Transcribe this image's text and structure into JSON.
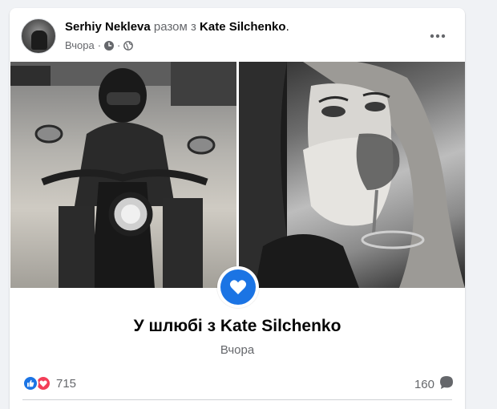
{
  "post": {
    "author_name": "Serhiy Nekleva",
    "with_text": "разом з",
    "tagged_name": "Kate Silchenko",
    "period": ".",
    "timestamp": "Вчора",
    "separator": "·",
    "icons": {
      "more": "more-horizontal-icon",
      "clock": "clock-icon",
      "audience": "globe-icon"
    }
  },
  "life_event": {
    "title": "У шлюбі з Kate Silchenko",
    "date": "Вчора",
    "icon": "heart-icon",
    "accent_color": "#1b74e4"
  },
  "footer": {
    "reaction_count": "715",
    "comment_count": "160",
    "reaction_icons": [
      "like-icon",
      "love-icon"
    ],
    "like_color": "#1b74e4",
    "love_color": "#f33e58"
  }
}
